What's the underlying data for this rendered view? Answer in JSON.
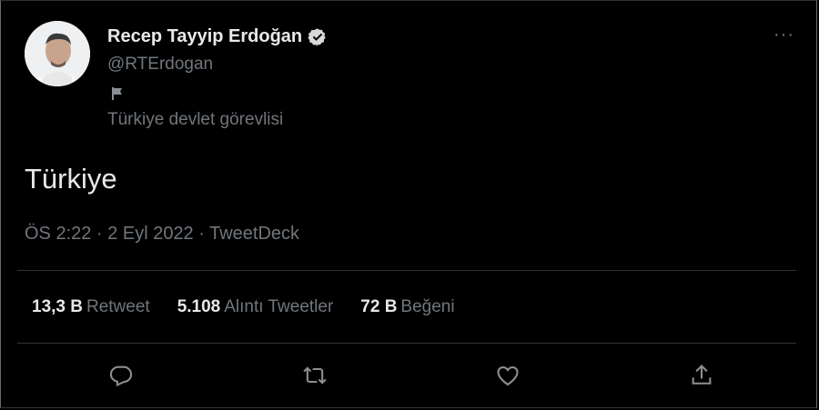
{
  "tweet": {
    "author": {
      "name": "Recep Tayyip Erdoğan",
      "handle": "@RTErdogan",
      "account_label": "Türkiye devlet görevlisi",
      "verified": true
    },
    "more_label": "···",
    "text": "Türkiye",
    "meta": {
      "time": "ÖS 2:22",
      "sep1": " · ",
      "date": "2 Eyl 2022",
      "sep2": " · ",
      "source": "TweetDeck"
    },
    "stats": [
      {
        "value": "13,3 B",
        "label": "Retweet"
      },
      {
        "value": "5.108",
        "label": "Alıntı Tweetler"
      },
      {
        "value": "72 B",
        "label": "Beğeni"
      }
    ],
    "actions": [
      "reply-icon",
      "retweet-icon",
      "like-icon",
      "share-icon"
    ]
  },
  "colors": {
    "background": "#000000",
    "primary_text": "#e7e9ea",
    "secondary_text": "#71767b",
    "divider": "#2f3336"
  }
}
